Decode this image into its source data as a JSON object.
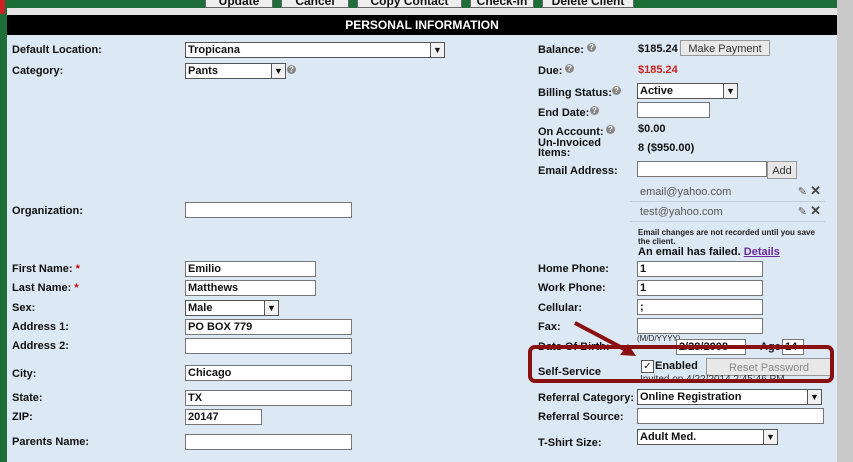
{
  "toolbar": {
    "update": "Update",
    "cancel": "Cancel",
    "copy_contact": "Copy Contact",
    "check_in": "Check-In",
    "delete_client": "Delete Client"
  },
  "section_title": "PERSONAL INFORMATION",
  "left": {
    "default_location_label": "Default Location:",
    "default_location_value": "Tropicana",
    "category_label": "Category:",
    "category_value": "Pants",
    "organization_label": "Organization:",
    "organization_value": "",
    "first_name_label": "First Name:",
    "first_name_value": "Emilio",
    "last_name_label": "Last Name:",
    "last_name_value": "Matthews",
    "required_mark": "*",
    "sex_label": "Sex:",
    "sex_value": "Male",
    "address1_label": "Address 1:",
    "address1_value": "PO BOX 779",
    "address2_label": "Address 2:",
    "address2_value": "",
    "city_label": "City:",
    "city_value": "Chicago",
    "state_label": "State:",
    "state_value": "TX",
    "zip_label": "ZIP:",
    "zip_value": "20147",
    "parents_name_label": "Parents Name:",
    "parents_name_value": ""
  },
  "right": {
    "balance_label": "Balance:",
    "balance_value": "$185.24",
    "make_payment": "Make Payment",
    "due_label": "Due:",
    "due_value": "$185.24",
    "billing_status_label": "Billing Status:",
    "billing_status_value": "Active",
    "end_date_label": "End Date:",
    "end_date_value": "",
    "on_account_label": "On Account:",
    "on_account_value": "$0.00",
    "uninvoiced_label_1": "Un-Invoiced",
    "uninvoiced_label_2": "Items:",
    "uninvoiced_value": "8 ($950.00)",
    "email_address_label": "Email Address:",
    "email_input_value": "",
    "add_button": "Add",
    "emails": [
      "email@yahoo.com",
      "test@yahoo.com"
    ],
    "email_note_1": "Email changes are not recorded until you save",
    "email_note_2": "the client.",
    "email_failed": "An email has failed.",
    "details_link": "Details",
    "home_phone_label": "Home Phone:",
    "home_phone_value": "1",
    "work_phone_label": "Work Phone:",
    "work_phone_value": "1",
    "cellular_label": "Cellular:",
    "cellular_value": ";",
    "fax_label": "Fax:",
    "fax_value": "",
    "dob_label": "Date Of Birth:",
    "dob_hint": "(M/D/YYYY)",
    "dob_value": "2/28/2008",
    "age_label": "Age:",
    "age_value": "14",
    "self_service_label": "Self-Service",
    "enabled_label": "Enabled",
    "reset_password": "Reset Password",
    "invited_text": "Invited on 4/22/2014 2:45:46 PM",
    "referral_category_label": "Referral Category:",
    "referral_category_value": "Online Registration",
    "referral_source_label": "Referral Source:",
    "referral_source_value": "",
    "tshirt_size_label": "T-Shirt Size:",
    "tshirt_size_value": "Adult Med."
  },
  "colors": {
    "header_bg": "#000000",
    "panel_bg": "#dce8f4",
    "due_red": "#cc2222",
    "highlight": "#8a1010"
  },
  "icons": {
    "help": "question-circle-icon",
    "edit": "pencil-icon",
    "delete": "close-icon",
    "dropdown": "chevron-down-icon",
    "checkbox": "checkbox-checked-icon",
    "annotation": "arrow-annotation"
  }
}
